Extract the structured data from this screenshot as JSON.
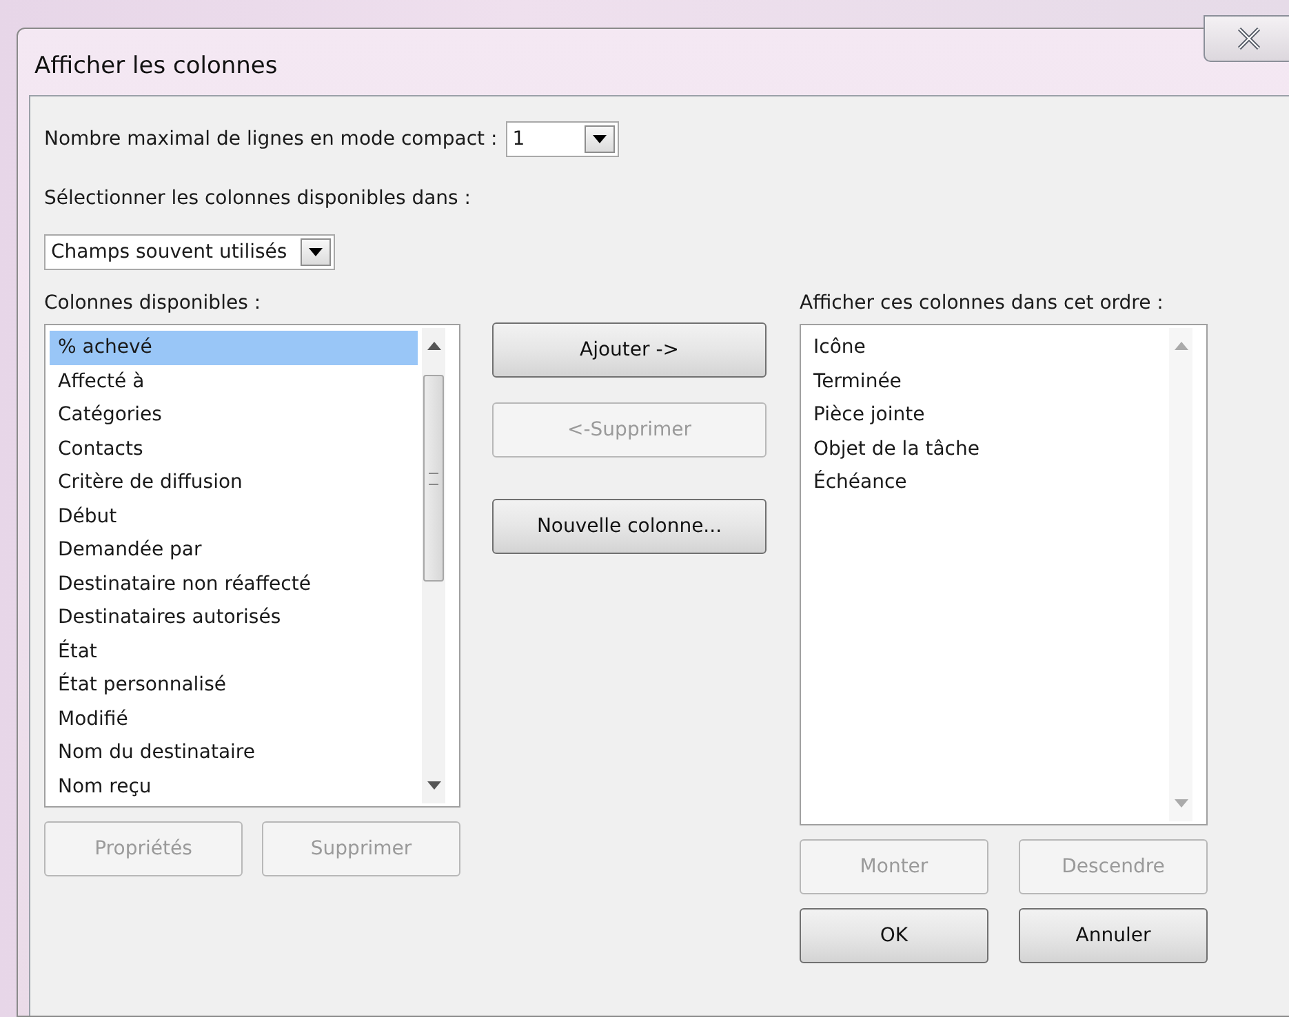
{
  "window": {
    "title": "Afficher les colonnes"
  },
  "max_lines": {
    "label": "Nombre maximal de lignes en mode compact :",
    "value": "1"
  },
  "source": {
    "label": "Sélectionner les colonnes disponibles dans :",
    "value": "Champs souvent utilisés"
  },
  "available": {
    "label": "Colonnes disponibles :",
    "items": [
      {
        "text": "% achevé",
        "selected": true
      },
      {
        "text": "Affecté à",
        "selected": false
      },
      {
        "text": "Catégories",
        "selected": false
      },
      {
        "text": "Contacts",
        "selected": false
      },
      {
        "text": "Critère de diffusion",
        "selected": false
      },
      {
        "text": "Début",
        "selected": false
      },
      {
        "text": "Demandée par",
        "selected": false
      },
      {
        "text": "Destinataire non réaffecté",
        "selected": false
      },
      {
        "text": "Destinataires autorisés",
        "selected": false
      },
      {
        "text": "État",
        "selected": false
      },
      {
        "text": "État personnalisé",
        "selected": false
      },
      {
        "text": "Modifié",
        "selected": false
      },
      {
        "text": "Nom du destinataire",
        "selected": false
      },
      {
        "text": "Nom reçu",
        "selected": false
      }
    ],
    "buttons": [
      {
        "label": "Propriétés",
        "disabled": true
      },
      {
        "label": "Supprimer",
        "disabled": true
      }
    ]
  },
  "middle_buttons": [
    {
      "label": "Ajouter ->",
      "disabled": false
    },
    {
      "label": "<-Supprimer",
      "disabled": true
    },
    {
      "label": "Nouvelle colonne...",
      "disabled": false
    }
  ],
  "shown": {
    "label": "Afficher ces colonnes dans cet ordre :",
    "items": [
      {
        "text": "Icône",
        "selected": false
      },
      {
        "text": "Terminée",
        "selected": false
      },
      {
        "text": "Pièce jointe",
        "selected": false
      },
      {
        "text": "Objet de la tâche",
        "selected": false
      },
      {
        "text": "Échéance",
        "selected": false
      }
    ],
    "buttons": [
      {
        "label": "Monter",
        "disabled": true
      },
      {
        "label": "Descendre",
        "disabled": true
      }
    ]
  },
  "footer_buttons": [
    {
      "label": "OK",
      "disabled": false
    },
    {
      "label": "Annuler",
      "disabled": false
    }
  ]
}
